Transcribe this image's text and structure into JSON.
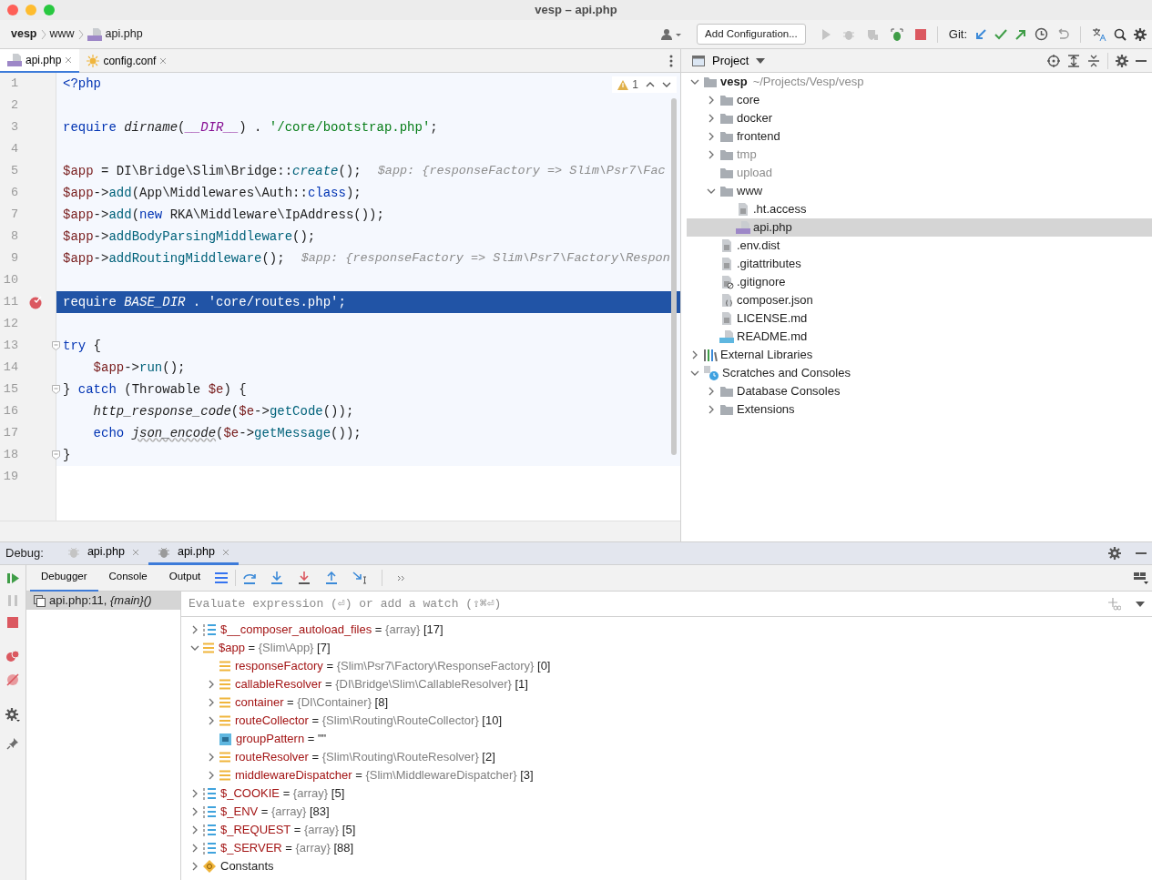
{
  "window": {
    "title": "vesp – api.php"
  },
  "breadcrumbs": [
    {
      "label": "vesp",
      "kind": "project"
    },
    {
      "label": "www",
      "kind": "folder"
    },
    {
      "label": "api.php",
      "kind": "php"
    }
  ],
  "toolbar": {
    "run_config": "Add Configuration...",
    "git_label": "Git:"
  },
  "editor_tabs": [
    {
      "label": "api.php",
      "kind": "php",
      "selected": true
    },
    {
      "label": "config.conf",
      "kind": "config",
      "selected": false
    }
  ],
  "inspection": {
    "warnings": "1"
  },
  "code_lines": [
    {
      "number": "1",
      "current": false,
      "breakpoint": false,
      "fold": false,
      "tokens": [
        {
          "kind": "kw",
          "text": "<?php"
        }
      ]
    },
    {
      "number": "2",
      "current": false,
      "breakpoint": false,
      "fold": false
    },
    {
      "number": "3",
      "current": false,
      "breakpoint": false,
      "fold": false,
      "tokens": [
        {
          "kind": "kw",
          "text": "require "
        },
        {
          "kind": "fn",
          "text": "dirname"
        },
        {
          "kind": "plain",
          "text": "("
        },
        {
          "kind": "const",
          "text": "__DIR__"
        },
        {
          "kind": "plain",
          "text": ") . "
        },
        {
          "kind": "str",
          "text": "'/core/bootstrap.php'"
        },
        {
          "kind": "plain",
          "text": ";"
        }
      ]
    },
    {
      "number": "4",
      "current": false,
      "breakpoint": false,
      "fold": false
    },
    {
      "number": "5",
      "current": false,
      "breakpoint": false,
      "fold": false,
      "tokens": [
        {
          "kind": "var",
          "text": "$app"
        },
        {
          "kind": "plain",
          "text": " = DI\\Bridge\\Slim\\Bridge::"
        },
        {
          "kind": "static",
          "text": "create"
        },
        {
          "kind": "plain",
          "text": "();"
        }
      ],
      "hint": "$app: {responseFactory => Slim\\Psr7\\Fac"
    },
    {
      "number": "6",
      "current": false,
      "breakpoint": false,
      "fold": false,
      "tokens": [
        {
          "kind": "var",
          "text": "$app"
        },
        {
          "kind": "plain",
          "text": "->"
        },
        {
          "kind": "call",
          "text": "add"
        },
        {
          "kind": "plain",
          "text": "(App\\Middlewares\\Auth::"
        },
        {
          "kind": "kw",
          "text": "class"
        },
        {
          "kind": "plain",
          "text": ");"
        }
      ]
    },
    {
      "number": "7",
      "current": false,
      "breakpoint": false,
      "fold": false,
      "tokens": [
        {
          "kind": "var",
          "text": "$app"
        },
        {
          "kind": "plain",
          "text": "->"
        },
        {
          "kind": "call",
          "text": "add"
        },
        {
          "kind": "plain",
          "text": "("
        },
        {
          "kind": "kw",
          "text": "new"
        },
        {
          "kind": "plain",
          "text": " RKA\\Middleware\\IpAddress());"
        }
      ]
    },
    {
      "number": "8",
      "current": false,
      "breakpoint": false,
      "fold": false,
      "tokens": [
        {
          "kind": "var",
          "text": "$app"
        },
        {
          "kind": "plain",
          "text": "->"
        },
        {
          "kind": "call",
          "text": "addBodyParsingMiddleware"
        },
        {
          "kind": "plain",
          "text": "();"
        }
      ]
    },
    {
      "number": "9",
      "current": false,
      "breakpoint": false,
      "fold": false,
      "tokens": [
        {
          "kind": "var",
          "text": "$app"
        },
        {
          "kind": "plain",
          "text": "->"
        },
        {
          "kind": "call",
          "text": "addRoutingMiddleware"
        },
        {
          "kind": "plain",
          "text": "();"
        }
      ],
      "hint": "$app: {responseFactory => Slim\\Psr7\\Factory\\Respon"
    },
    {
      "number": "10",
      "current": false,
      "breakpoint": false,
      "fold": false
    },
    {
      "number": "11",
      "current": true,
      "breakpoint": true,
      "fold": false,
      "tokens": [
        {
          "kind": "kw",
          "text": "require "
        },
        {
          "kind": "fn",
          "text": "BASE_DIR"
        },
        {
          "kind": "plain",
          "text": " . "
        },
        {
          "kind": "str",
          "text": "'core/routes.php'"
        },
        {
          "kind": "plain",
          "text": ";"
        }
      ]
    },
    {
      "number": "12",
      "current": false,
      "breakpoint": false,
      "fold": false
    },
    {
      "number": "13",
      "current": false,
      "breakpoint": false,
      "fold": true,
      "tokens": [
        {
          "kind": "kw",
          "text": "try"
        },
        {
          "kind": "plain",
          "text": " {"
        }
      ]
    },
    {
      "number": "14",
      "current": false,
      "breakpoint": false,
      "fold": false,
      "tokens": [
        {
          "kind": "var",
          "text": "    $app"
        },
        {
          "kind": "plain",
          "text": "->"
        },
        {
          "kind": "call",
          "text": "run"
        },
        {
          "kind": "plain",
          "text": "();"
        }
      ]
    },
    {
      "number": "15",
      "current": false,
      "breakpoint": false,
      "fold": true,
      "tokens": [
        {
          "kind": "plain",
          "text": "} "
        },
        {
          "kind": "kw",
          "text": "catch"
        },
        {
          "kind": "plain",
          "text": " (Throwable "
        },
        {
          "kind": "var",
          "text": "$e"
        },
        {
          "kind": "plain",
          "text": ") {"
        }
      ]
    },
    {
      "number": "16",
      "current": false,
      "breakpoint": false,
      "fold": false,
      "tokens": [
        {
          "kind": "fn",
          "text": "    http_response_code"
        },
        {
          "kind": "plain",
          "text": "("
        },
        {
          "kind": "var",
          "text": "$e"
        },
        {
          "kind": "plain",
          "text": "->"
        },
        {
          "kind": "call",
          "text": "getCode"
        },
        {
          "kind": "plain",
          "text": "());"
        }
      ]
    },
    {
      "number": "17",
      "current": false,
      "breakpoint": false,
      "fold": false,
      "tokens": [
        {
          "kind": "kw",
          "text": "    echo "
        },
        {
          "kind": "fnw",
          "text": "json_encode"
        },
        {
          "kind": "plain",
          "text": "("
        },
        {
          "kind": "var",
          "text": "$e"
        },
        {
          "kind": "plain",
          "text": "->"
        },
        {
          "kind": "call",
          "text": "getMessage"
        },
        {
          "kind": "plain",
          "text": "());"
        }
      ]
    },
    {
      "number": "18",
      "current": false,
      "breakpoint": false,
      "fold": true,
      "tokens": [
        {
          "kind": "plain",
          "text": "}"
        }
      ]
    },
    {
      "number": "19",
      "current": false,
      "breakpoint": false,
      "fold": false
    }
  ],
  "project": {
    "title": "Project",
    "tree": [
      {
        "label": "vesp",
        "path": "~/Projects/Vesp/vesp",
        "kind": "folder",
        "expanded": true,
        "selected": false,
        "children": [
          {
            "label": "core",
            "kind": "folder",
            "expanded": false,
            "selected": false
          },
          {
            "label": "docker",
            "kind": "folder",
            "expanded": false,
            "selected": false
          },
          {
            "label": "frontend",
            "kind": "folder",
            "expanded": false,
            "selected": false
          },
          {
            "label": "tmp",
            "kind": "folder",
            "expanded": false,
            "excluded": true,
            "selected": false
          },
          {
            "label": "upload",
            "kind": "folder",
            "excluded": true,
            "selected": false
          },
          {
            "label": "www",
            "kind": "folder",
            "expanded": true,
            "selected": false,
            "children": [
              {
                "label": ".ht.access",
                "kind": "file",
                "selected": false
              },
              {
                "label": "api.php",
                "kind": "php",
                "selected": true
              }
            ]
          },
          {
            "label": ".env.dist",
            "kind": "file",
            "selected": false
          },
          {
            "label": ".gitattributes",
            "kind": "file",
            "selected": false
          },
          {
            "label": ".gitignore",
            "kind": "ignore",
            "selected": false
          },
          {
            "label": "composer.json",
            "kind": "json",
            "selected": false
          },
          {
            "label": "LICENSE.md",
            "kind": "file",
            "selected": false
          },
          {
            "label": "README.md",
            "kind": "md",
            "selected": false
          }
        ]
      },
      {
        "label": "External Libraries",
        "kind": "libraries",
        "expanded": false,
        "selected": false
      },
      {
        "label": "Scratches and Consoles",
        "kind": "scratches",
        "expanded": true,
        "selected": false,
        "children": [
          {
            "label": "Database Consoles",
            "kind": "folder",
            "expanded": false,
            "selected": false
          },
          {
            "label": "Extensions",
            "kind": "folder",
            "expanded": false,
            "selected": false
          }
        ]
      }
    ]
  },
  "debug": {
    "label": "Debug:",
    "sessions": [
      {
        "label": "api.php",
        "selected": false
      },
      {
        "label": "api.php",
        "selected": true
      }
    ],
    "tabs": [
      {
        "label": "Debugger",
        "selected": true
      },
      {
        "label": "Console",
        "selected": false
      },
      {
        "label": "Output",
        "selected": false
      }
    ],
    "frames": [
      {
        "text": "api.php:11, *{main}()*",
        "selected": true
      }
    ],
    "watch_placeholder": "Evaluate expression (⏎) or add a watch (⇧⌘⏎)",
    "variables": [
      {
        "name": "$__composer_autoload_files",
        "op": "=",
        "type": "{array}",
        "count": "[17]",
        "kind": "array",
        "expanded": false
      },
      {
        "name": "$app",
        "op": "=",
        "type": "{Slim\\App}",
        "count": "[7]",
        "kind": "object",
        "expanded": true,
        "children": [
          {
            "name": "responseFactory",
            "op": "=",
            "type": "{Slim\\Psr7\\Factory\\ResponseFactory}",
            "count": "[0]",
            "kind": "object"
          },
          {
            "name": "callableResolver",
            "op": "=",
            "type": "{DI\\Bridge\\Slim\\CallableResolver}",
            "count": "[1]",
            "kind": "object",
            "expanded": false
          },
          {
            "name": "container",
            "op": "=",
            "type": "{DI\\Container}",
            "count": "[8]",
            "kind": "object",
            "expanded": false
          },
          {
            "name": "routeCollector",
            "op": "=",
            "type": "{Slim\\Routing\\RouteCollector}",
            "count": "[10]",
            "kind": "object",
            "expanded": false
          },
          {
            "name": "groupPattern",
            "op": "=",
            "value": "\"\"",
            "kind": "string"
          },
          {
            "name": "routeResolver",
            "op": "=",
            "type": "{Slim\\Routing\\RouteResolver}",
            "count": "[2]",
            "kind": "object",
            "expanded": false
          },
          {
            "name": "middlewareDispatcher",
            "op": "=",
            "type": "{Slim\\MiddlewareDispatcher}",
            "count": "[3]",
            "kind": "object",
            "expanded": false
          }
        ]
      },
      {
        "name": "$_COOKIE",
        "op": "=",
        "type": "{array}",
        "count": "[5]",
        "kind": "array",
        "expanded": false
      },
      {
        "name": "$_ENV",
        "op": "=",
        "type": "{array}",
        "count": "[83]",
        "kind": "array",
        "expanded": false
      },
      {
        "name": "$_REQUEST",
        "op": "=",
        "type": "{array}",
        "count": "[5]",
        "kind": "array",
        "expanded": false
      },
      {
        "name": "$_SERVER",
        "op": "=",
        "type": "{array}",
        "count": "[88]",
        "kind": "array",
        "expanded": false
      },
      {
        "name": "Constants",
        "kind": "constants",
        "expanded": false
      }
    ]
  }
}
